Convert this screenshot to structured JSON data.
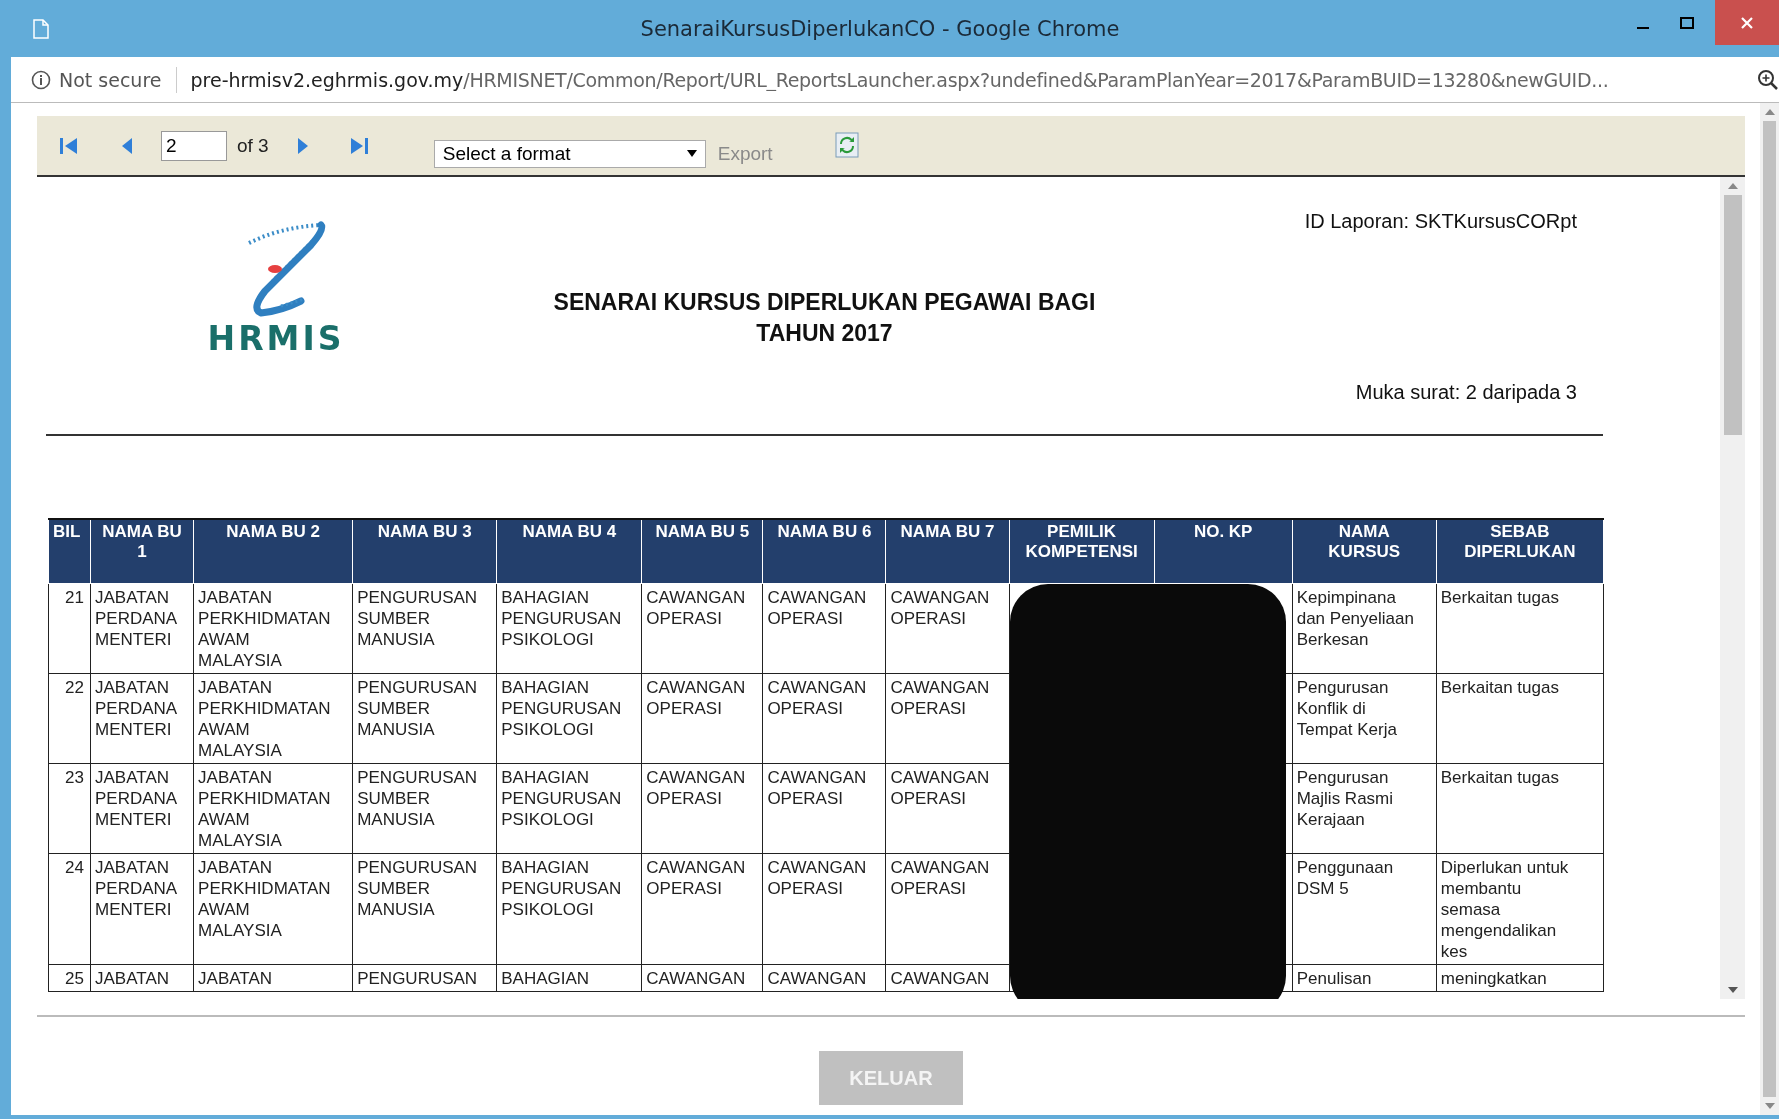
{
  "window": {
    "title": "SenaraiKursusDiperlukanCO - Google Chrome"
  },
  "address_bar": {
    "security": "Not secure",
    "url_host": "pre-hrmisv2.eghrmis.gov.my",
    "url_path": "/HRMISNET/Common/Report/URL_ReportsLauncher.aspx?undefined&ParamPlanYear=2017&ParamBUID=13280&newGUID..."
  },
  "toolbar": {
    "page": "2",
    "page_of": "of 3",
    "format_placeholder": "Select a format",
    "export": "Export",
    "export_disabled": true
  },
  "report": {
    "logo_text": "HRMIS",
    "title_lines": [
      "SENARAI KURSUS DIPERLUKAN PEGAWAI BAGI",
      "TAHUN 2017"
    ],
    "report_id": "ID Laporan: SKTKursusCORpt",
    "page_info": "Muka surat: 2 daripada 3",
    "table": {
      "redacted": true,
      "columns": [
        "BIL",
        "NAMA BU\n1",
        "NAMA BU 2",
        "NAMA BU 3",
        "NAMA BU 4",
        "NAMA BU 5",
        "NAMA BU 6",
        "NAMA BU 7",
        "PEMILIK\nKOMPETENSI",
        "NO. KP",
        "NAMA\nKURSUS",
        "SEBAB\nDIPERLUKAN"
      ],
      "rows": [
        {
          "bil": "21",
          "units": [
            "JABATAN\nPERDANA\nMENTERI",
            "JABATAN\nPERKHIDMATAN\nAWAM\nMALAYSIA",
            "PENGURUSAN\nSUMBER\nMANUSIA",
            "BAHAGIAN\nPENGURUSAN\nPSIKOLOGI",
            "CAWANGAN\nOPERASI",
            "CAWANGAN\nOPERASI",
            "CAWANGAN\nOPERASI"
          ],
          "course": "Kepimpinana\ndan Penyeliaan\nBerkesan",
          "reason": "Berkaitan tugas"
        },
        {
          "bil": "22",
          "units": [
            "JABATAN\nPERDANA\nMENTERI",
            "JABATAN\nPERKHIDMATAN\nAWAM\nMALAYSIA",
            "PENGURUSAN\nSUMBER\nMANUSIA",
            "BAHAGIAN\nPENGURUSAN\nPSIKOLOGI",
            "CAWANGAN\nOPERASI",
            "CAWANGAN\nOPERASI",
            "CAWANGAN\nOPERASI"
          ],
          "course": "Pengurusan\nKonflik di\nTempat Kerja",
          "reason": "Berkaitan tugas"
        },
        {
          "bil": "23",
          "units": [
            "JABATAN\nPERDANA\nMENTERI",
            "JABATAN\nPERKHIDMATAN\nAWAM\nMALAYSIA",
            "PENGURUSAN\nSUMBER\nMANUSIA",
            "BAHAGIAN\nPENGURUSAN\nPSIKOLOGI",
            "CAWANGAN\nOPERASI",
            "CAWANGAN\nOPERASI",
            "CAWANGAN\nOPERASI"
          ],
          "course": "Pengurusan\nMajlis Rasmi\nKerajaan",
          "reason": "Berkaitan tugas"
        },
        {
          "bil": "24",
          "units": [
            "JABATAN\nPERDANA\nMENTERI",
            "JABATAN\nPERKHIDMATAN\nAWAM\nMALAYSIA",
            "PENGURUSAN\nSUMBER\nMANUSIA",
            "BAHAGIAN\nPENGURUSAN\nPSIKOLOGI",
            "CAWANGAN\nOPERASI",
            "CAWANGAN\nOPERASI",
            "CAWANGAN\nOPERASI"
          ],
          "course": "Penggunaan\nDSM 5",
          "reason": "Diperlukan untuk\nmembantu\nsemasa\nmengendalikan\nkes"
        },
        {
          "bil": "25",
          "units": [
            "JABATAN",
            "JABATAN",
            "PENGURUSAN",
            "BAHAGIAN",
            "CAWANGAN",
            "CAWANGAN",
            "CAWANGAN"
          ],
          "course": "Penulisan",
          "reason": "meningkatkan"
        }
      ]
    }
  },
  "buttons": [
    {
      "label": "KELUAR",
      "disabled": true
    }
  ]
}
